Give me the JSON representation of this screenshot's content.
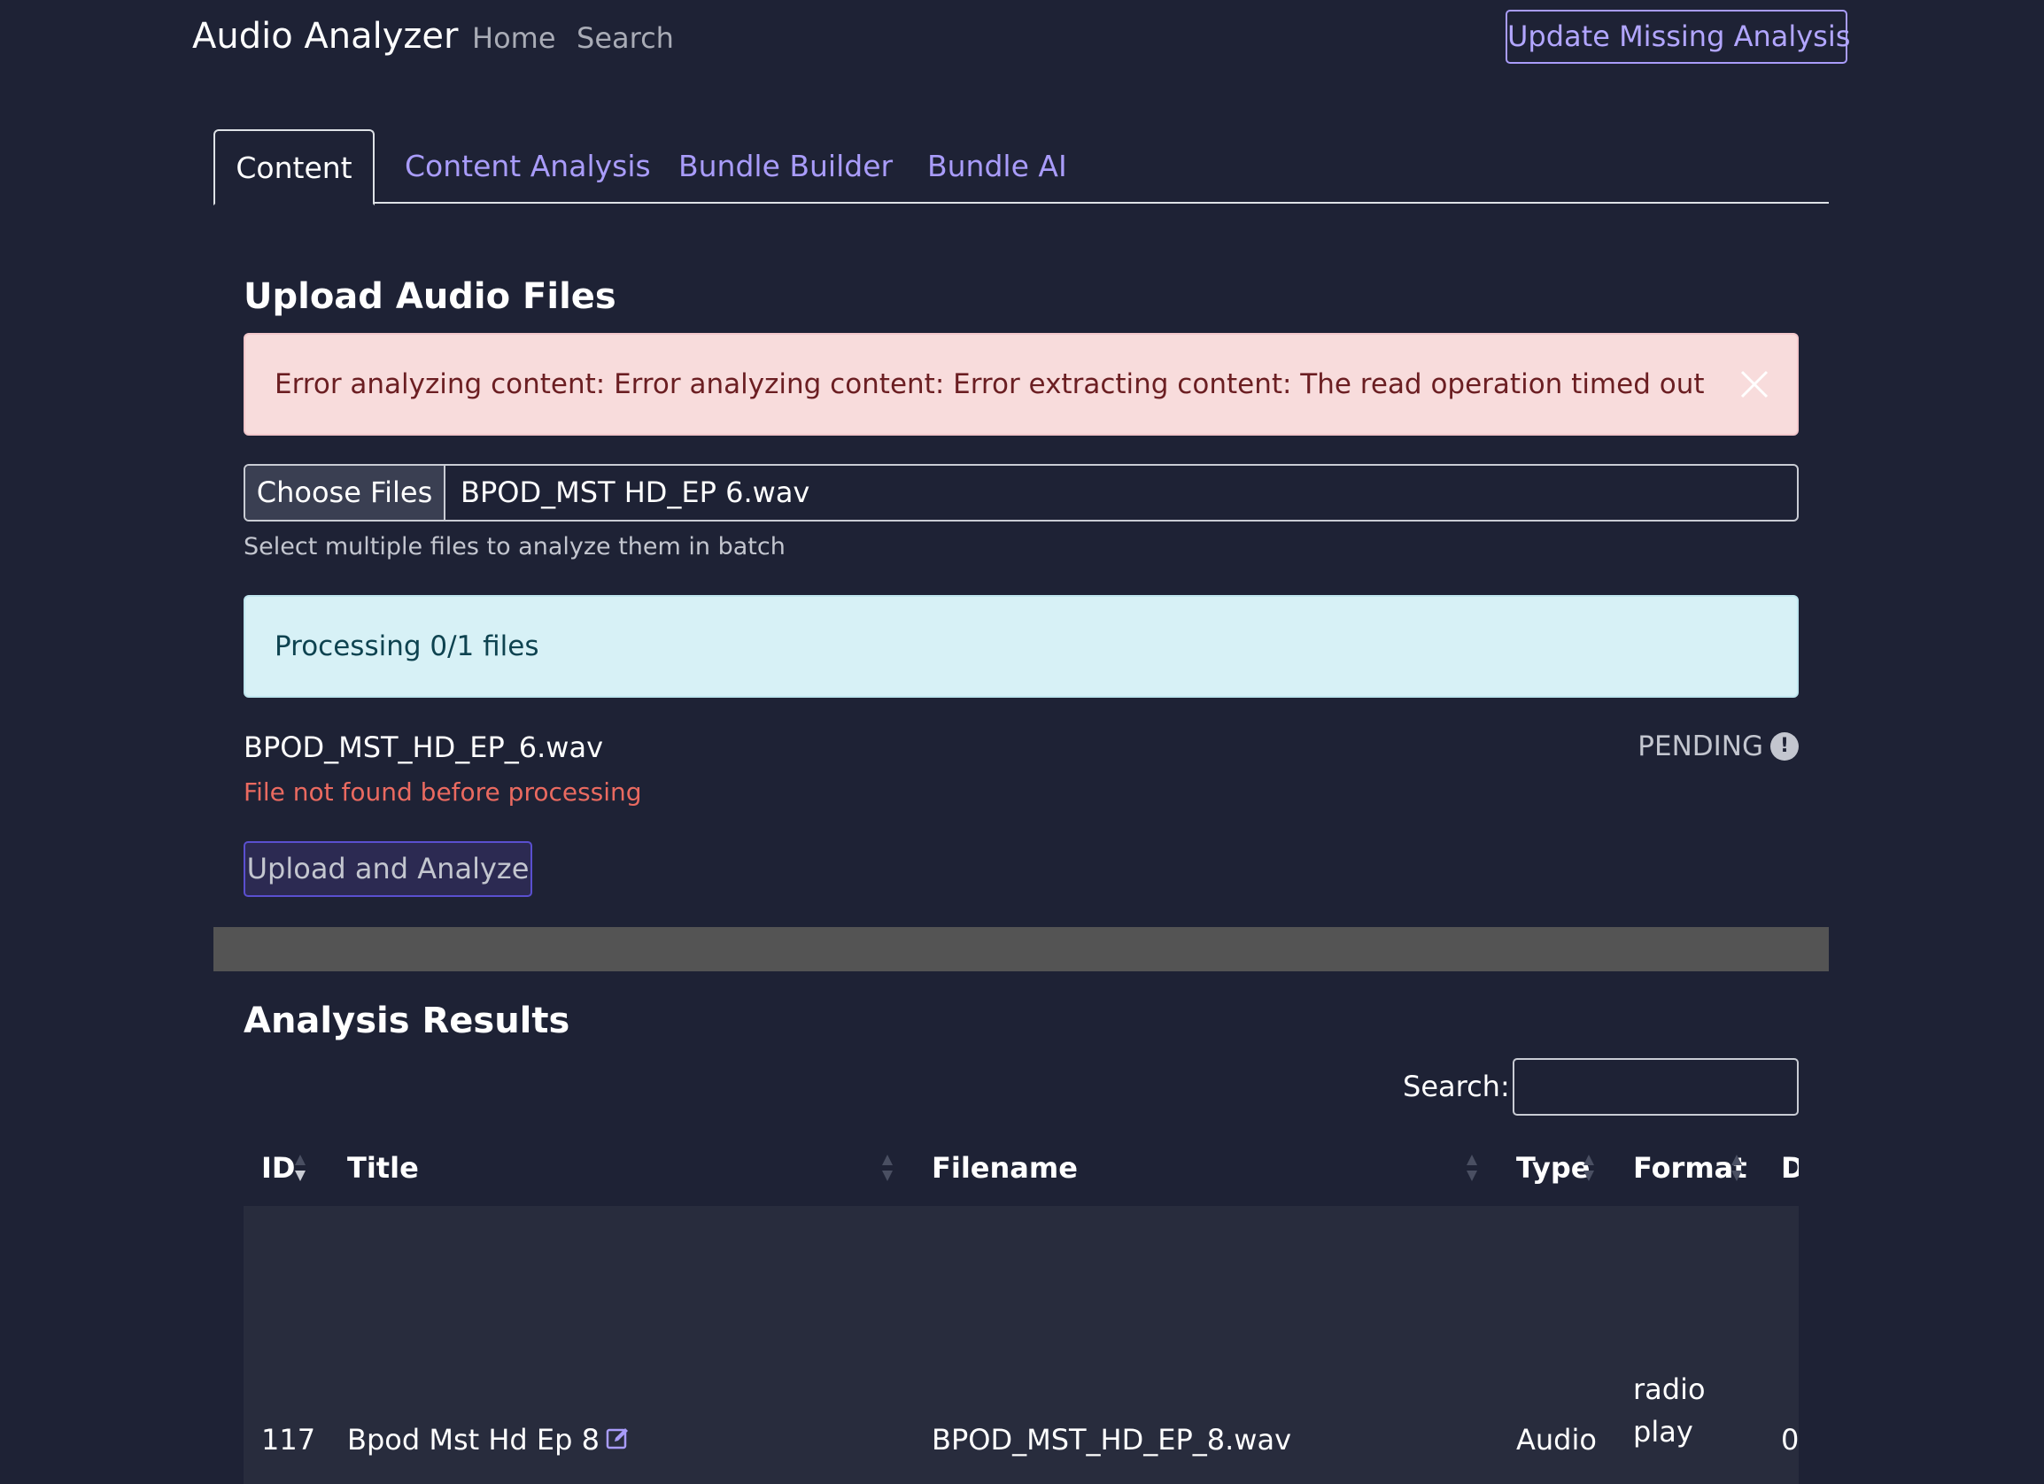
{
  "navbar": {
    "brand": "Audio Analyzer",
    "links": [
      "Home",
      "Search"
    ],
    "update_button": "Update Missing Analysis"
  },
  "tabs": [
    {
      "label": "Content",
      "active": true
    },
    {
      "label": "Content Analysis",
      "active": false
    },
    {
      "label": "Bundle Builder",
      "active": false
    },
    {
      "label": "Bundle AI",
      "active": false
    }
  ],
  "upload": {
    "title": "Upload Audio Files",
    "error_message": "Error analyzing content: Error analyzing content: Error extracting content: The read operation timed out",
    "choose_button": "Choose Files",
    "selected_file": "BPOD_MST HD_EP 6.wav",
    "help_text": "Select multiple files to analyze them in batch",
    "progress_message": "Processing 0/1 files",
    "file_item": {
      "name": "BPOD_MST_HD_EP_6.wav",
      "status": "PENDING",
      "status_icon": "exclamation-circle-icon",
      "error": "File not found before processing"
    },
    "submit_button": "Upload and Analyze"
  },
  "results": {
    "title": "Analysis Results",
    "search_label": "Search:",
    "search_value": "",
    "columns": [
      "ID",
      "Title",
      "Filename",
      "Type",
      "Format",
      "D"
    ],
    "rows": [
      {
        "id": "117",
        "title": "Bpod Mst Hd Ep 8",
        "filename": "BPOD_MST_HD_EP_8.wav",
        "type": "Audio",
        "format_line1": "radio",
        "format_line2": "play",
        "d": "0"
      }
    ]
  },
  "colors": {
    "background": "#1e2235",
    "accent": "#a99cfa",
    "danger_bg": "#f8dcdc",
    "danger_text": "#6b1e22",
    "info_bg": "#d7f1f6",
    "info_text": "#0e4350",
    "error_text": "#ea6a60",
    "separator": "#545454",
    "row_bg": "#282c3d"
  }
}
